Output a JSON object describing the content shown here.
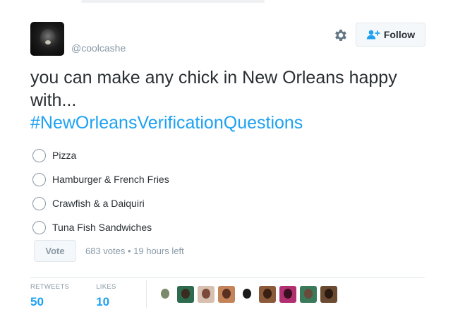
{
  "user": {
    "handle": "@coolcashe"
  },
  "header": {
    "follow_label": "Follow"
  },
  "tweet": {
    "text": "you can make any chick in New Orleans happy with...",
    "hashtag": "#NewOrleansVerificationQuestions"
  },
  "poll": {
    "options": [
      "Pizza",
      "Hamburger & French Fries",
      "Crawfish & a Daiquiri",
      "Tuna Fish Sandwiches"
    ],
    "vote_label": "Vote",
    "meta": "683 votes • 19 hours left"
  },
  "stats": {
    "retweets_label": "RETWEETS",
    "retweets_value": "50",
    "likes_label": "LIKES",
    "likes_value": "10"
  },
  "colors": {
    "link": "#1da1f2",
    "muted": "#8899a6",
    "text": "#292f33",
    "border": "#e1e8ed"
  },
  "likers": [
    {
      "name": "liker-avatar-1",
      "bg": "#ffffff",
      "fg": "#7a8a6a"
    },
    {
      "name": "liker-avatar-2",
      "bg": "#2e6b4e",
      "fg": "#3b2a20"
    },
    {
      "name": "liker-avatar-3",
      "bg": "#d8c0b0",
      "fg": "#7a4a3a"
    },
    {
      "name": "liker-avatar-4",
      "bg": "#c4845a",
      "fg": "#5a3020"
    },
    {
      "name": "liker-avatar-5",
      "bg": "#ffffff",
      "fg": "#1a1a1a"
    },
    {
      "name": "liker-avatar-6",
      "bg": "#8a5a3a",
      "fg": "#3a2010"
    },
    {
      "name": "liker-avatar-7",
      "bg": "#b03070",
      "fg": "#3a1020"
    },
    {
      "name": "liker-avatar-8",
      "bg": "#3a7a5a",
      "fg": "#6a4a3a"
    },
    {
      "name": "liker-avatar-9",
      "bg": "#6a4a30",
      "fg": "#2a1a10"
    }
  ]
}
